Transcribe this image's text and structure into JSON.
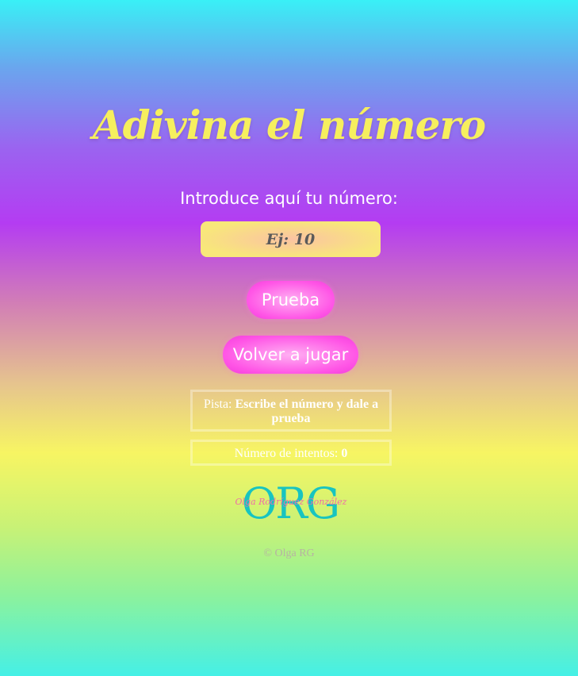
{
  "page": {
    "title": "Adivina el número",
    "input_label": "Introduce aquí tu número:",
    "input_placeholder": "Ej: 10",
    "input_value": ""
  },
  "buttons": {
    "check_label": "Prueba",
    "reset_label": "Volver a jugar"
  },
  "hint": {
    "label": "Pista:",
    "message": "Escribe el número y dale a prueba"
  },
  "attempts": {
    "label": "Número de intentos:",
    "count": "0"
  },
  "logo": {
    "letters": "ORG",
    "script": "Olga Rodríguez González"
  },
  "footer": {
    "copyright": "© Olga RG"
  },
  "colors": {
    "title": "#f6ef5e",
    "button": "#ff55e6",
    "input_bg": "#f8e77a",
    "logo": "#18c4c0"
  }
}
